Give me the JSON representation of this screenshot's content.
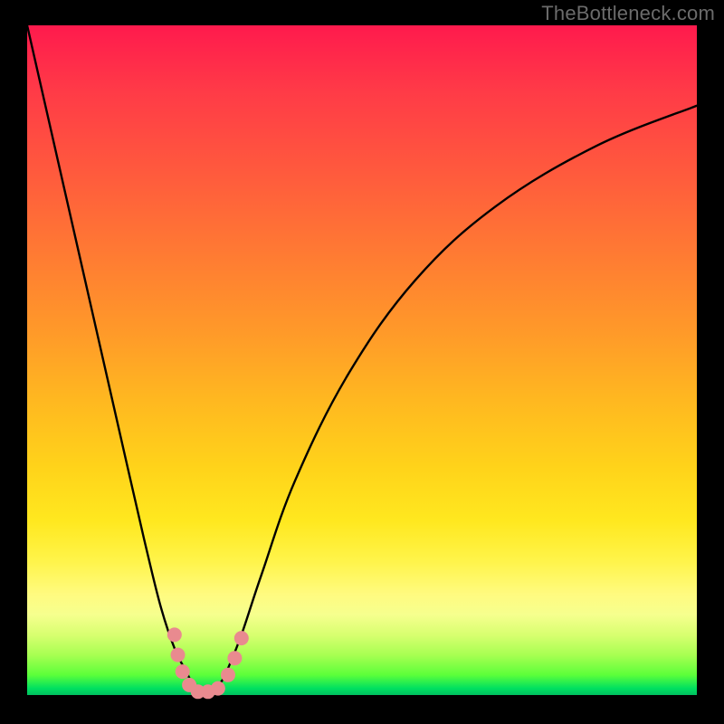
{
  "watermark": "TheBottleneck.com",
  "chart_data": {
    "type": "line",
    "title": "",
    "xlabel": "",
    "ylabel": "",
    "xlim": [
      0,
      100
    ],
    "ylim": [
      0,
      100
    ],
    "grid": false,
    "series": [
      {
        "name": "bottleneck-curve",
        "x": [
          0,
          5,
          10,
          15,
          18,
          20,
          22,
          24,
          25,
          26,
          27,
          28,
          29,
          30,
          32,
          35,
          40,
          48,
          58,
          70,
          85,
          100
        ],
        "values": [
          100,
          78,
          56,
          34,
          21,
          13,
          7,
          3,
          1,
          0,
          0,
          1,
          2,
          4,
          9,
          18,
          32,
          48,
          62,
          73,
          82,
          88
        ]
      }
    ],
    "markers": {
      "name": "highlight-dots",
      "color": "#e98a8f",
      "points": [
        {
          "x": 22.0,
          "y": 9.0,
          "r": 8
        },
        {
          "x": 22.5,
          "y": 6.0,
          "r": 8
        },
        {
          "x": 23.2,
          "y": 3.5,
          "r": 8
        },
        {
          "x": 24.2,
          "y": 1.5,
          "r": 8
        },
        {
          "x": 25.5,
          "y": 0.5,
          "r": 8
        },
        {
          "x": 27.0,
          "y": 0.5,
          "r": 8
        },
        {
          "x": 28.5,
          "y": 1.0,
          "r": 8
        },
        {
          "x": 30.0,
          "y": 3.0,
          "r": 8
        },
        {
          "x": 31.0,
          "y": 5.5,
          "r": 8
        },
        {
          "x": 32.0,
          "y": 8.5,
          "r": 8
        }
      ]
    },
    "background_gradient": {
      "top": "#ff1a4d",
      "mid": "#ffd31a",
      "bottom": "#00c060"
    }
  }
}
